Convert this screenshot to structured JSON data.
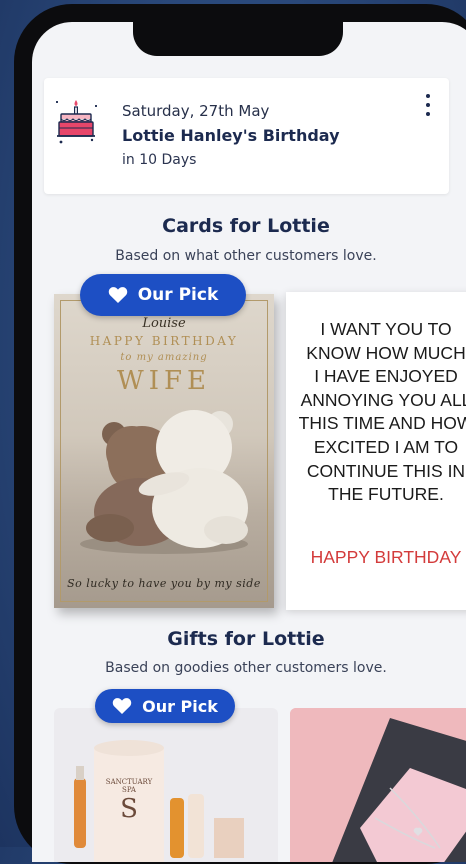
{
  "event": {
    "date": "Saturday, 27th May",
    "title": "Lottie Hanley's Birthday",
    "when": "in 10 Days"
  },
  "cards_section": {
    "title": "Cards for Lottie",
    "subtitle": "Based on what other customers love.",
    "badge": "Our Pick",
    "card1": {
      "name": "Louise",
      "line1": "HAPPY BIRTHDAY",
      "line2": "to my amazing",
      "line3": "WIFE",
      "footer": "So lucky to have you by my side"
    },
    "card2": {
      "text": "I WANT YOU TO\nKNOW HOW MUCH\nI HAVE ENJOYED\nANNOYING YOU ALL\nTHIS TIME AND HOW\nEXCITED I AM TO\nCONTINUE THIS IN\nTHE FUTURE.",
      "hb": "HAPPY BIRTHDAY"
    }
  },
  "gifts_section": {
    "title": "Gifts for Lottie",
    "subtitle": "Based on goodies other customers love.",
    "badge": "Our Pick",
    "gift1_brand": "SANCTUARY SPA",
    "gift1_letter": "S"
  }
}
